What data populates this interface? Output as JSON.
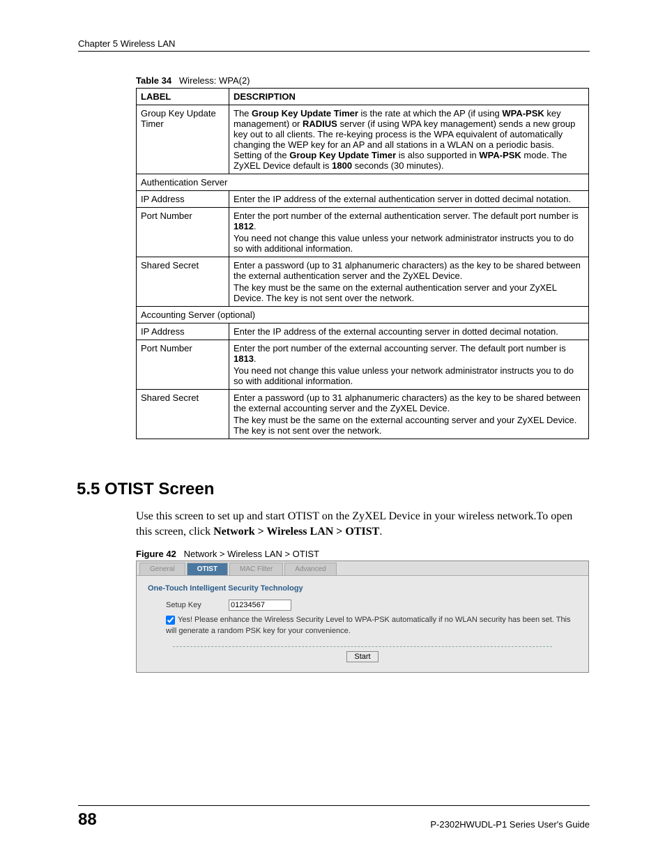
{
  "header": {
    "chapter": "Chapter 5 Wireless LAN"
  },
  "table_caption": {
    "label": "Table 34",
    "title": "Wireless: WPA(2)"
  },
  "table": {
    "col_label": "LABEL",
    "col_desc": "DESCRIPTION",
    "rows": [
      {
        "label": "Group Key Update Timer",
        "desc_html": "The <b>Group Key Update Timer</b> is the rate at which the AP (if using <b>WPA-PSK</b> key management) or <b>RADIUS</b> server (if using WPA key management) sends a new group key out to all clients. The re-keying process is the WPA equivalent of automatically changing the WEP key for an AP and all stations in a WLAN on a periodic basis. Setting of the <b>Group Key Update Timer</b> is also supported in <b>WPA-PSK</b> mode. The ZyXEL Device default is <b>1800</b> seconds (30 minutes)."
      },
      {
        "section": "Authentication Server"
      },
      {
        "label": "IP Address",
        "desc_html": "Enter the IP address of the external authentication server in dotted decimal notation."
      },
      {
        "label": "Port Number",
        "desc_html": "<p class=\"desc-p\">Enter the port number of the external authentication server. The default port number is <b>1812</b>.</p><p class=\"desc-p\">You need not change this value unless your network administrator instructs you to do so with additional information.</p>"
      },
      {
        "label": "Shared Secret",
        "desc_html": "<p class=\"desc-p\">Enter a password (up to 31 alphanumeric characters) as the key to be shared between the external authentication server and the ZyXEL Device.</p><p class=\"desc-p\">The key must be the same on the external authentication server and your ZyXEL Device. The key is not sent over the network.</p>"
      },
      {
        "section": "Accounting Server (optional)"
      },
      {
        "label": "IP Address",
        "desc_html": "Enter the IP address of the external accounting server in dotted decimal notation."
      },
      {
        "label": "Port Number",
        "desc_html": "<p class=\"desc-p\">Enter the port number of the external accounting server. The default port number is <b>1813</b>.</p><p class=\"desc-p\">You need not change this value unless your network administrator instructs you to do so with additional information.</p>"
      },
      {
        "label": "Shared Secret",
        "desc_html": "<p class=\"desc-p\">Enter a password (up to 31 alphanumeric characters) as the key to be shared between the external accounting server and the ZyXEL Device.</p><p class=\"desc-p\">The key must be the same on the external accounting server and your ZyXEL Device. The key is not sent over the network.</p>"
      }
    ]
  },
  "section_5_5": {
    "heading": "5.5  OTIST Screen",
    "body_pre": "Use this screen to set up and start OTIST on the ZyXEL Device in your wireless network.To open this screen, click ",
    "body_bold": "Network > Wireless LAN > OTIST",
    "body_post": "."
  },
  "figure_caption": {
    "label": "Figure 42",
    "title": "Network > Wireless LAN > OTIST"
  },
  "screenshot": {
    "tabs": [
      "General",
      "OTIST",
      "MAC Filter",
      "Advanced"
    ],
    "active_tab": 1,
    "panel_title": "One-Touch Intelligent Security Technology",
    "setup_key_label": "Setup Key",
    "setup_key_value": "01234567",
    "checkbox_text": "Yes! Please enhance the Wireless Security Level to WPA-PSK automatically if no WLAN security has been set. This will generate a random PSK key for your convenience.",
    "start_label": "Start"
  },
  "footer": {
    "page_number": "88",
    "guide": "P-2302HWUDL-P1 Series User's Guide"
  }
}
